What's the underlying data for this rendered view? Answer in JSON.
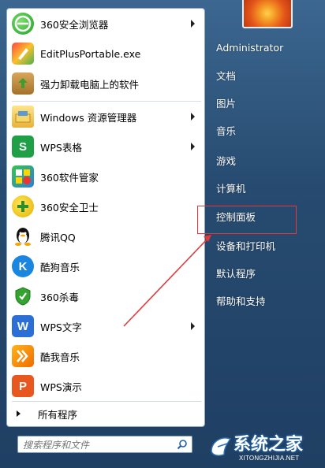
{
  "pinned": [
    {
      "label": "360安全浏览器",
      "has_arrow": true,
      "icon": "browser-360-icon"
    },
    {
      "label": "EditPlusPortable.exe",
      "has_arrow": false,
      "icon": "editplus-icon"
    },
    {
      "label": "强力卸载电脑上的软件",
      "has_arrow": false,
      "icon": "uninstall-icon"
    }
  ],
  "recent": [
    {
      "label": "Windows 资源管理器",
      "has_arrow": true,
      "icon": "explorer-folder-icon"
    },
    {
      "label": "WPS表格",
      "has_arrow": true,
      "icon": "wps-sheet-icon"
    },
    {
      "label": "360软件管家",
      "has_arrow": false,
      "icon": "software-manager-icon"
    },
    {
      "label": "360安全卫士",
      "has_arrow": false,
      "icon": "security-guard-icon"
    },
    {
      "label": "腾讯QQ",
      "has_arrow": false,
      "icon": "qq-penguin-icon"
    },
    {
      "label": "酷狗音乐",
      "has_arrow": false,
      "icon": "kugou-icon"
    },
    {
      "label": "360杀毒",
      "has_arrow": false,
      "icon": "antivirus-icon"
    },
    {
      "label": "WPS文字",
      "has_arrow": true,
      "icon": "wps-writer-icon"
    },
    {
      "label": "酷我音乐",
      "has_arrow": false,
      "icon": "kuwo-icon"
    },
    {
      "label": "WPS演示",
      "has_arrow": false,
      "icon": "wps-presentation-icon"
    }
  ],
  "all_programs": "所有程序",
  "search_placeholder": "搜索程序和文件",
  "right_items": [
    "Administrator",
    "文档",
    "图片",
    "音乐",
    "游戏",
    "计算机",
    "控制面板",
    "设备和打印机",
    "默认程序",
    "帮助和支持"
  ],
  "highlighted_item": "控制面板",
  "watermark": {
    "text": "系统之家",
    "sub": "XITONGZHIJIA.NET"
  },
  "colors": {
    "highlight": "#e23a3a",
    "arrow": "#e23a3a",
    "panel_bg": "#274b70"
  }
}
